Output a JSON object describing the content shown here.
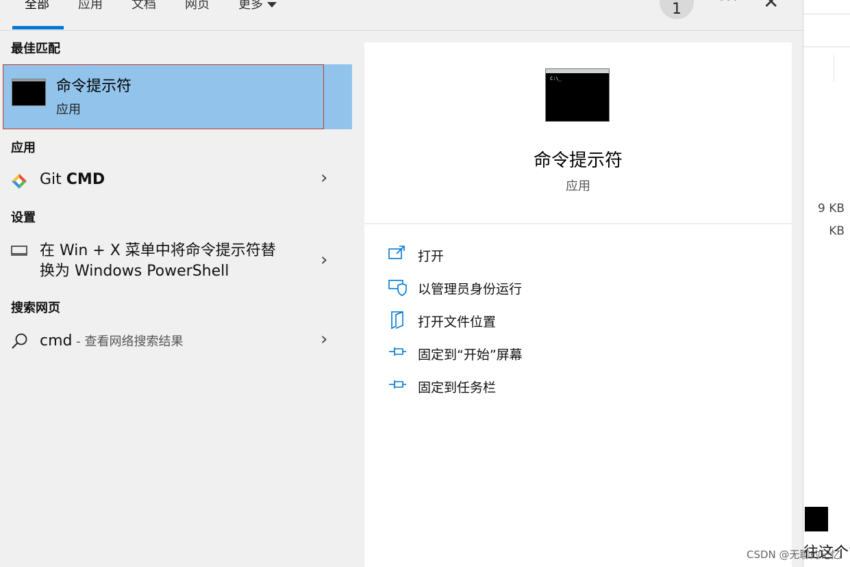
{
  "tabs": [
    {
      "label": "全部",
      "active": true
    },
    {
      "label": "应用"
    },
    {
      "label": "文档"
    },
    {
      "label": "网页"
    },
    {
      "label": "更多"
    }
  ],
  "header": {
    "badge": "1",
    "more_label": "···",
    "close_label": "✕"
  },
  "sections": {
    "best_match": "最佳匹配",
    "apps": "应用",
    "settings": "设置",
    "web": "搜索网页"
  },
  "best_match": {
    "title": "命令提示符",
    "subtitle": "应用"
  },
  "apps": [
    {
      "name_prefix": "Git ",
      "name_bold": "CMD"
    }
  ],
  "settings": [
    {
      "line1": "在 Win + X 菜单中将命令提示符替",
      "line2": "换为 Windows PowerShell"
    }
  ],
  "web": [
    {
      "query": "cmd",
      "hint": " - 查看网络搜索结果"
    }
  ],
  "preview": {
    "title": "命令提示符",
    "subtitle": "应用"
  },
  "actions": [
    {
      "label": "打开",
      "icon": "open-icon"
    },
    {
      "label": "以管理员身份运行",
      "icon": "shield-icon"
    },
    {
      "label": "打开文件位置",
      "icon": "folder-icon"
    },
    {
      "label": "固定到“开始”屏幕",
      "icon": "pin-icon"
    },
    {
      "label": "固定到任务栏",
      "icon": "pin-icon"
    }
  ],
  "background": {
    "kb1": "9 KB",
    "kb2": "KB",
    "partial_text": "往这个管"
  },
  "watermark": "CSDN @无聊的记忆",
  "colors": {
    "accent": "#0078d4",
    "selection": "#92c3ea",
    "panel": "#f0f0f0"
  }
}
